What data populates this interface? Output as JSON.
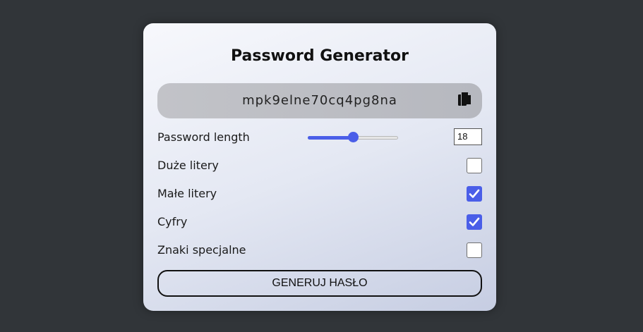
{
  "app": {
    "title": "Password Generator"
  },
  "password": {
    "value": "mpk9elne70cq4pg8na",
    "copy_icon": "copy-icon"
  },
  "length": {
    "label": "Password length",
    "value": "18",
    "min": 4,
    "max": 32
  },
  "options": [
    {
      "label": "Duże litery",
      "checked": false
    },
    {
      "label": "Małe litery",
      "checked": true
    },
    {
      "label": "Cyfry",
      "checked": true
    },
    {
      "label": "Znaki specjalne",
      "checked": false
    }
  ],
  "generate_button": {
    "label": "GENERUJ HASŁO"
  },
  "colors": {
    "accent": "#4a5ee8",
    "background": "#313539"
  }
}
